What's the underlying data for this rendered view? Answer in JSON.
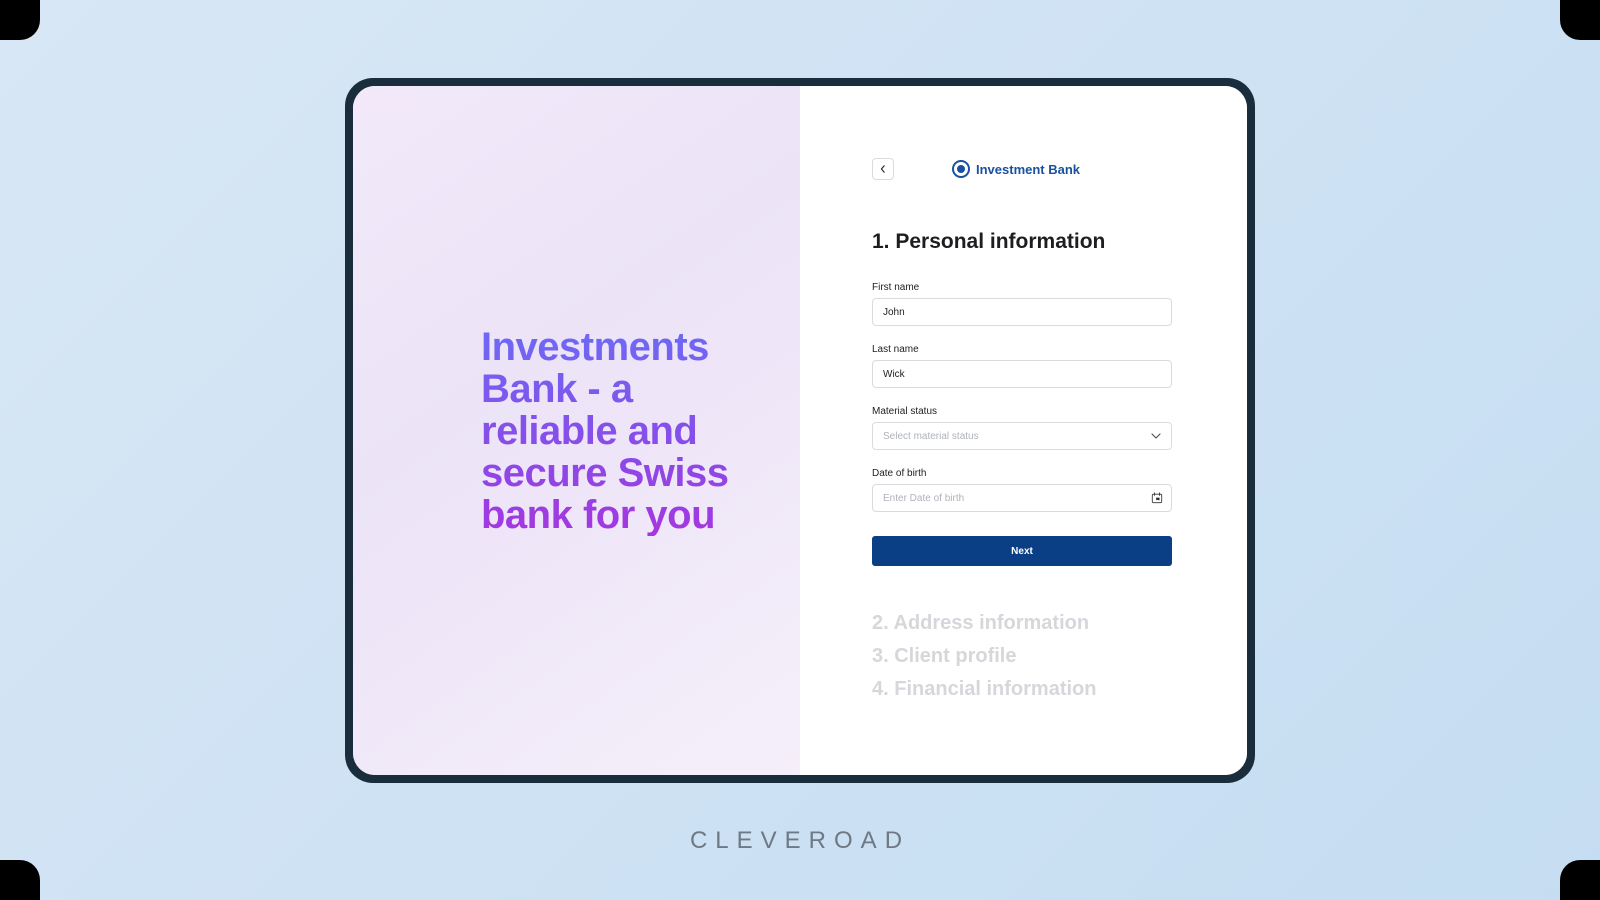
{
  "brand": {
    "name": "Investment Bank"
  },
  "left": {
    "tagline": "Investments Bank - a reliable and secure Swiss bank for you"
  },
  "form": {
    "step_title": "1. Personal information",
    "fields": {
      "first_name": {
        "label": "First name",
        "value": "John"
      },
      "last_name": {
        "label": "Last name",
        "value": "Wick"
      },
      "material_status": {
        "label": "Material status",
        "placeholder": "Select material status"
      },
      "dob": {
        "label": "Date of birth",
        "placeholder": "Enter Date of birth"
      }
    },
    "next_label": "Next"
  },
  "upcoming": [
    "2. Address information",
    "3. Client profile",
    "4. Financial information"
  ],
  "watermark": "CLEVEROAD"
}
